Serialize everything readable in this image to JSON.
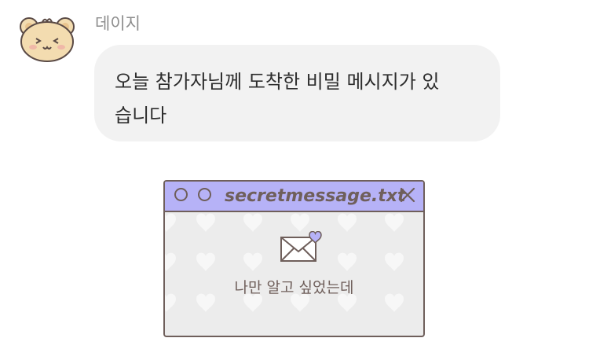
{
  "sender": {
    "name": "데이지",
    "avatar_icon": "bear-icon"
  },
  "message": {
    "lines": [
      "오늘 참가자님께 도착한 비밀 메시지가 있",
      "습니다"
    ]
  },
  "window": {
    "title": "secretmessage.txt",
    "body_text": "나만 알고 싶었는데",
    "titlebar_color": "#b6b2f7",
    "border_color": "#6f5f5b",
    "icons": [
      "window-dot-icon",
      "window-dot-icon",
      "close-icon",
      "envelope-heart-icon"
    ]
  },
  "colors": {
    "bubble": "#f2f2f2",
    "sender_text": "#8e8e8e",
    "message_text": "#2d2d2d"
  }
}
